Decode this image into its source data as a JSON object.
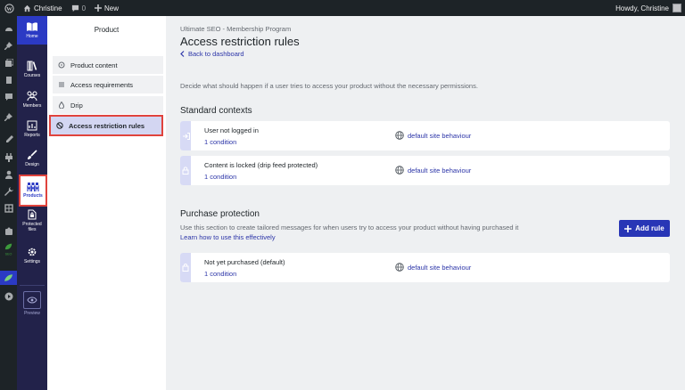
{
  "adminbar": {
    "site_name": "Christine",
    "comments_count": "0",
    "new_label": "New",
    "howdy": "Howdy, Christine"
  },
  "appnav": {
    "items": [
      {
        "label": "Home",
        "icon": "book-icon"
      },
      {
        "label": "Courses",
        "icon": "books-icon"
      },
      {
        "label": "Members",
        "icon": "members-icon"
      },
      {
        "label": "Reports",
        "icon": "reports-icon"
      },
      {
        "label": "Design",
        "icon": "brush-icon"
      },
      {
        "label": "Products",
        "icon": "products-icon"
      },
      {
        "label": "Protected files",
        "icon": "protected-file-icon"
      },
      {
        "label": "Settings",
        "icon": "gear-icon"
      },
      {
        "label": "Preview",
        "icon": "eye-icon"
      }
    ]
  },
  "subnav": {
    "title": "Product",
    "items": [
      {
        "label": "Product content"
      },
      {
        "label": "Access requirements"
      },
      {
        "label": "Drip"
      },
      {
        "label": "Access restriction rules"
      }
    ]
  },
  "main": {
    "breadcrumb": "Ultimate SEO - Membership Program",
    "title": "Access restriction rules",
    "back": "Back to dashboard",
    "description": "Decide what should happen if a user tries to access your product without the necessary permissions.",
    "standard": {
      "heading": "Standard contexts",
      "rows": [
        {
          "title": "User not logged in",
          "condition": "1 condition",
          "behaviour": "default site behaviour"
        },
        {
          "title": "Content is locked (drip feed protected)",
          "condition": "1 condition",
          "behaviour": "default site behaviour"
        }
      ]
    },
    "purchase": {
      "heading": "Purchase protection",
      "description": "Use this section to create tailored messages for when users try to access your product without having purchased it",
      "learn_link": "Learn how to use this effectively",
      "add_rule": "Add rule",
      "rows": [
        {
          "title": "Not yet purchased (default)",
          "condition": "1 condition",
          "behaviour": "default site behaviour"
        }
      ]
    }
  },
  "colors": {
    "accent": "#2836b6",
    "highlight_border": "#e0433d",
    "nav_bg": "#22224a",
    "admin_bg": "#1d2327"
  }
}
